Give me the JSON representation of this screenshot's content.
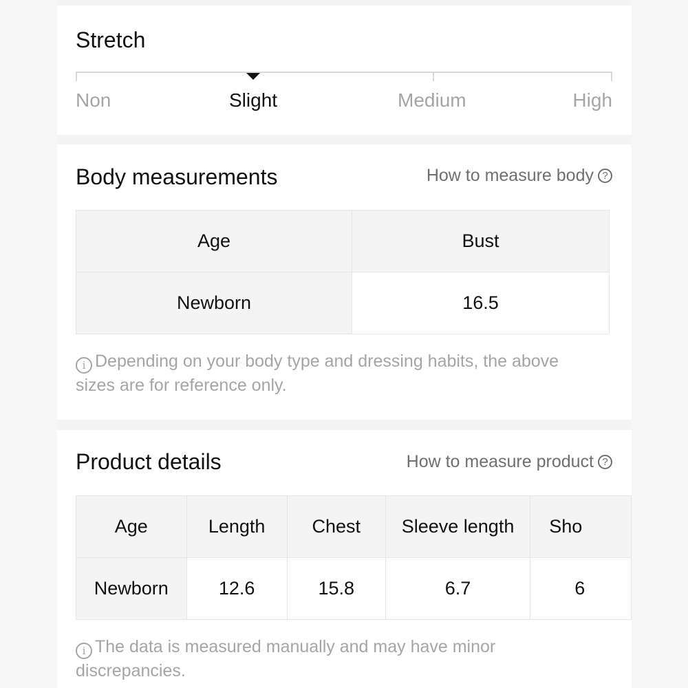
{
  "stretch": {
    "title": "Stretch",
    "levels": [
      "Non",
      "Slight",
      "Medium",
      "High"
    ],
    "selected": "Slight"
  },
  "body_measurements": {
    "title": "Body measurements",
    "link": "How to measure body",
    "link_icon": "question-circle-icon",
    "headers": [
      "Age",
      "Bust"
    ],
    "rows": [
      [
        "Newborn",
        "16.5"
      ]
    ],
    "note_icon": "info-circle-icon",
    "note": "Depending on your body type and dressing habits, the above sizes are for reference only."
  },
  "product_details": {
    "title": "Product details",
    "link": "How to measure product",
    "link_icon": "question-circle-icon",
    "headers": [
      "Age",
      "Length",
      "Chest",
      "Sleeve length",
      "Sho"
    ],
    "rows": [
      [
        "Newborn",
        "12.6",
        "15.8",
        "6.7",
        "6"
      ]
    ],
    "note_icon": "info-circle-icon",
    "note": "The data is measured manually and may have minor discrepancies."
  }
}
